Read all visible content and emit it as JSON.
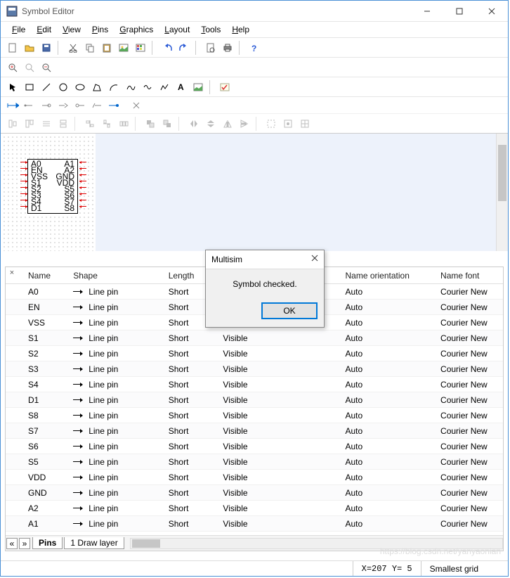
{
  "window": {
    "title": "Symbol Editor"
  },
  "menus": [
    "File",
    "Edit",
    "View",
    "Pins",
    "Graphics",
    "Layout",
    "Tools",
    "Help"
  ],
  "symbol": {
    "rows": [
      [
        "A0",
        "A1"
      ],
      [
        "EN",
        "A2"
      ],
      [
        "VSS",
        "GND"
      ],
      [
        "S1",
        "VDD"
      ],
      [
        "S2",
        "S5"
      ],
      [
        "S3",
        "S6"
      ],
      [
        "S4",
        "S7"
      ],
      [
        "D1",
        "S8"
      ]
    ]
  },
  "table": {
    "headers": {
      "name": "Name",
      "shape": "Shape",
      "length": "Length",
      "vis": "Name orientation",
      "orient": "Name orientation",
      "font": "Name font",
      "visLabel": ""
    },
    "cols": [
      "Name",
      "Shape",
      "Length",
      "",
      "Name orientation",
      "Name font"
    ],
    "shape_label": "Line pin",
    "length_label": "Short",
    "vis_label": "Visible",
    "orient_label": "Auto",
    "font_label": "Courier New",
    "rows": [
      "A0",
      "EN",
      "VSS",
      "S1",
      "S2",
      "S3",
      "S4",
      "D1",
      "S8",
      "S7",
      "S6",
      "S5",
      "VDD",
      "GND",
      "A2",
      "A1"
    ]
  },
  "tabs": {
    "pins": "Pins",
    "layer": "1 Draw layer"
  },
  "status": {
    "coords": "X=207 Y=   5",
    "grid": "Smallest grid"
  },
  "dialog": {
    "title": "Multisim",
    "msg": "Symbol checked.",
    "ok": "OK"
  },
  "watermark": "https://blog.csdn.net/yanyaonian"
}
